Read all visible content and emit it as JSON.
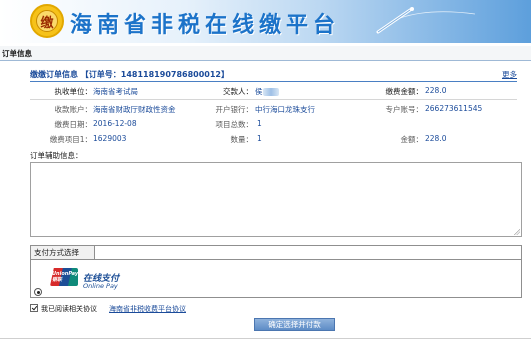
{
  "banner": {
    "logo_char": "缴",
    "title": "海南省非税在线缴平台"
  },
  "breadcrumb": "订单信息",
  "order": {
    "title": "缴缴订单信息 【订单号：14811819078680001​2】",
    "more": "更多"
  },
  "rows": {
    "r1": {
      "unit_label": "执收单位：",
      "unit_value": "海南省考试局",
      "payer_label": "交款人：",
      "payer_value": "侯",
      "amount_label": "缴费金额：",
      "amount_value": "228.0"
    },
    "r2": {
      "account_label": "收款账户：",
      "account_value": "海南省财政厅财政性资金",
      "bank_label": "开户银行：",
      "bank_value": "中行海口龙珠支行",
      "acctno_label": "专户账号：",
      "acctno_value": "266273611545"
    },
    "r3": {
      "date_label": "缴费日期：",
      "date_value": "2016-12-08",
      "itemcount_label": "项目总数：",
      "itemcount_value": "1"
    },
    "r4": {
      "item_label": "缴费项目1：",
      "item_value": "1629003",
      "qty_label": "数量：",
      "qty_value": "1",
      "money_label": "金额：",
      "money_value": "228.0"
    }
  },
  "aux": {
    "label": "订单辅助信息：",
    "value": ""
  },
  "payment": {
    "tab_label": "支付方式选择",
    "unionpay_logo": "UnionPay 银联",
    "online_pay": "在线支付",
    "online_pay_en": "Online Pay"
  },
  "agree": {
    "text": "我已阅读相关协议",
    "link": "海南省非税收费平台协议"
  },
  "submit_label": "确定选择并付款",
  "colors": {
    "link_blue": "#1b4b9a",
    "banner_title": "#1c73c9",
    "button": "#6d98cf"
  }
}
